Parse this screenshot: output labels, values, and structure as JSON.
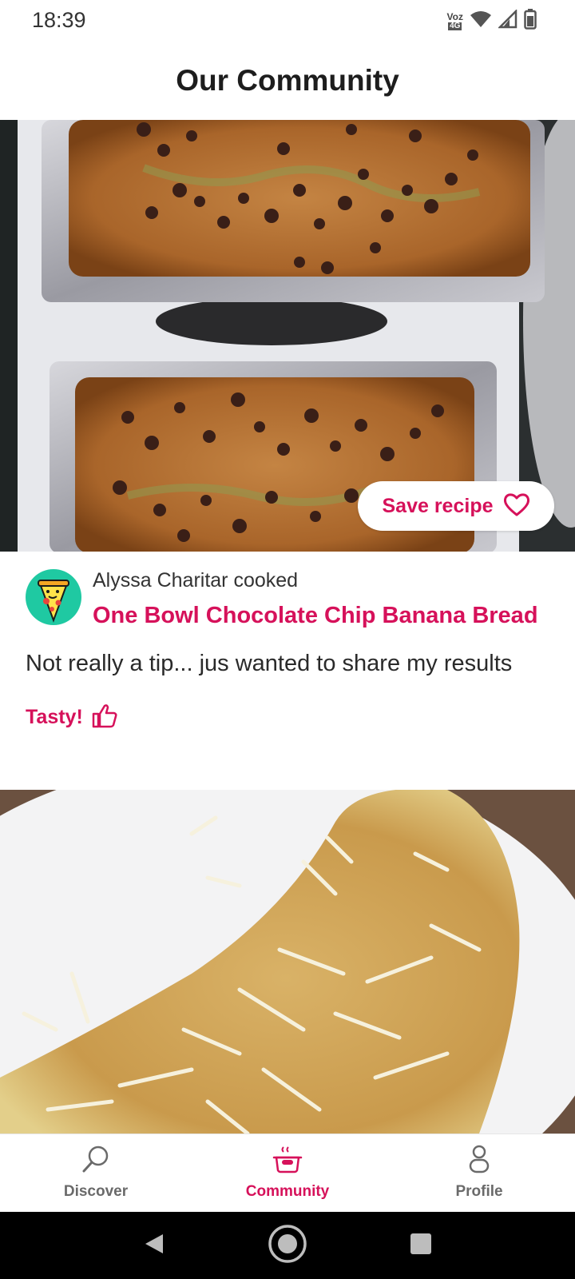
{
  "status_bar": {
    "time": "18:39",
    "volte_top": "Voz",
    "volte_bottom": "4G",
    "icons": [
      "wifi-icon",
      "signal-icon",
      "battery-icon"
    ]
  },
  "header": {
    "title": "Our Community"
  },
  "feed": {
    "posts": [
      {
        "photo_subject": "chocolate-chip-banana-bread-loaves",
        "save_label": "Save recipe",
        "author_line": "Alyssa Charitar cooked",
        "recipe_title": "One Bowl Chocolate Chip Banana Bread",
        "comment": "Not really a tip... jus wanted to share my results",
        "reaction_label": "Tasty!"
      },
      {
        "photo_subject": "cheese-omelette-on-plate"
      }
    ]
  },
  "bottom_nav": {
    "items": [
      {
        "label": "Discover",
        "icon": "search-icon",
        "active": false
      },
      {
        "label": "Community",
        "icon": "pot-icon",
        "active": true
      },
      {
        "label": "Profile",
        "icon": "person-icon",
        "active": false
      }
    ]
  },
  "colors": {
    "accent": "#d6115a",
    "nav_inactive": "#6a6a6a",
    "avatar_bg": "#1fc9a2"
  }
}
